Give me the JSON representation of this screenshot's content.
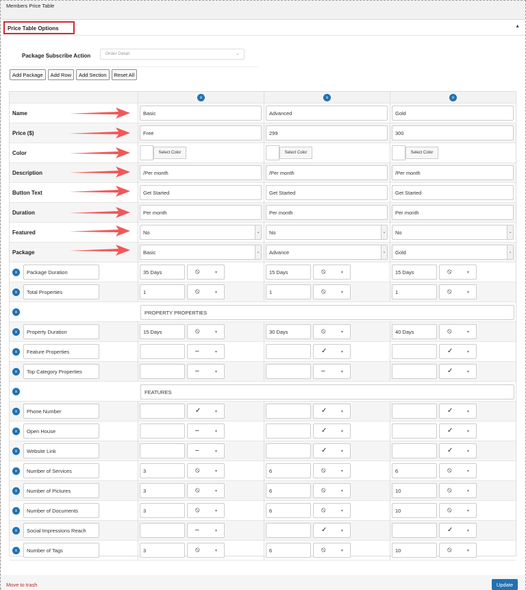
{
  "page_title": "Members Price Table",
  "panel": {
    "title": "Price Table Options",
    "collapse_icon": "▲"
  },
  "subscribe": {
    "label": "Package Subscribe Action",
    "value": "Order Detail"
  },
  "buttons": [
    "Add Package",
    "Add Row",
    "Add Section",
    "Reset All"
  ],
  "columns": [
    {
      "name": "Basic",
      "price": "Free",
      "color_btn": "Select Color",
      "description": "/Per month",
      "button_text": "Get Started",
      "duration": "Per month",
      "featured": "No",
      "package": "Basic"
    },
    {
      "name": "Advanced",
      "price": "299",
      "color_btn": "Select Color",
      "description": "/Per month",
      "button_text": "Get Started",
      "duration": "Per month",
      "featured": "No",
      "package": "Advance"
    },
    {
      "name": "Gold",
      "price": "300",
      "color_btn": "Select Color",
      "description": "/Per month",
      "button_text": "Get Started",
      "duration": "Per month",
      "featured": "No",
      "package": "Gold"
    }
  ],
  "fixed_labels": [
    "Name",
    "Price ($)",
    "Color",
    "Description",
    "Button Text",
    "Duration",
    "Featured",
    "Package"
  ],
  "rows": [
    {
      "type": "item",
      "label": "Package Duration",
      "cells": [
        {
          "v": "35 Days",
          "i": "⦸"
        },
        {
          "v": "15 Days",
          "i": "⦸"
        },
        {
          "v": "15 Days",
          "i": "⦸"
        }
      ]
    },
    {
      "type": "item",
      "label": "Total Properties",
      "cells": [
        {
          "v": "1",
          "i": "⦸"
        },
        {
          "v": "1",
          "i": "⦸"
        },
        {
          "v": "1",
          "i": "⦸"
        }
      ]
    },
    {
      "type": "section",
      "label": "PROPERTY PROPERTIES"
    },
    {
      "type": "item",
      "label": "Property Duration",
      "cells": [
        {
          "v": "15 Days",
          "i": "⦸"
        },
        {
          "v": "30 Days",
          "i": "⦸"
        },
        {
          "v": "40 Days",
          "i": "⦸"
        }
      ]
    },
    {
      "type": "item",
      "label": "Feature Properties",
      "cells": [
        {
          "v": "",
          "i": "–"
        },
        {
          "v": "",
          "i": "✓"
        },
        {
          "v": "",
          "i": "✓"
        }
      ]
    },
    {
      "type": "item",
      "label": "Top Category Properties",
      "cells": [
        {
          "v": "",
          "i": "–"
        },
        {
          "v": "",
          "i": "–"
        },
        {
          "v": "",
          "i": "✓"
        }
      ]
    },
    {
      "type": "section",
      "label": "FEATURES"
    },
    {
      "type": "item",
      "label": "Phone Number",
      "cells": [
        {
          "v": "",
          "i": "✓"
        },
        {
          "v": "",
          "i": "✓"
        },
        {
          "v": "",
          "i": "✓"
        }
      ]
    },
    {
      "type": "item",
      "label": "Open House",
      "cells": [
        {
          "v": "",
          "i": "–"
        },
        {
          "v": "",
          "i": "✓"
        },
        {
          "v": "",
          "i": "✓"
        }
      ]
    },
    {
      "type": "item",
      "label": "Website Link",
      "cells": [
        {
          "v": "",
          "i": "–"
        },
        {
          "v": "",
          "i": "✓"
        },
        {
          "v": "",
          "i": "✓"
        }
      ]
    },
    {
      "type": "item",
      "label": "Number of Services",
      "cells": [
        {
          "v": "3",
          "i": "⦸"
        },
        {
          "v": "6",
          "i": "⦸"
        },
        {
          "v": "6",
          "i": "⦸"
        }
      ]
    },
    {
      "type": "item",
      "label": "Number of Pictures",
      "cells": [
        {
          "v": "3",
          "i": "⦸"
        },
        {
          "v": "6",
          "i": "⦸"
        },
        {
          "v": "10",
          "i": "⦸"
        }
      ]
    },
    {
      "type": "item",
      "label": "Number of Documents",
      "cells": [
        {
          "v": "3",
          "i": "⦸"
        },
        {
          "v": "6",
          "i": "⦸"
        },
        {
          "v": "10",
          "i": "⦸"
        }
      ]
    },
    {
      "type": "item",
      "label": "Social Impressions Reach",
      "cells": [
        {
          "v": "",
          "i": "–"
        },
        {
          "v": "",
          "i": "✓"
        },
        {
          "v": "",
          "i": "✓"
        }
      ]
    },
    {
      "type": "item",
      "label": "Number of Tags",
      "cells": [
        {
          "v": "3",
          "i": "⦸"
        },
        {
          "v": "6",
          "i": "⦸"
        },
        {
          "v": "10",
          "i": "⦸"
        }
      ]
    }
  ],
  "remove_icon": "x",
  "dropdown_caret": "▾",
  "select_arrow": "⌄",
  "annotation_color": "#f25757",
  "footer": {
    "trash": "Move to trash",
    "update": "Update"
  }
}
